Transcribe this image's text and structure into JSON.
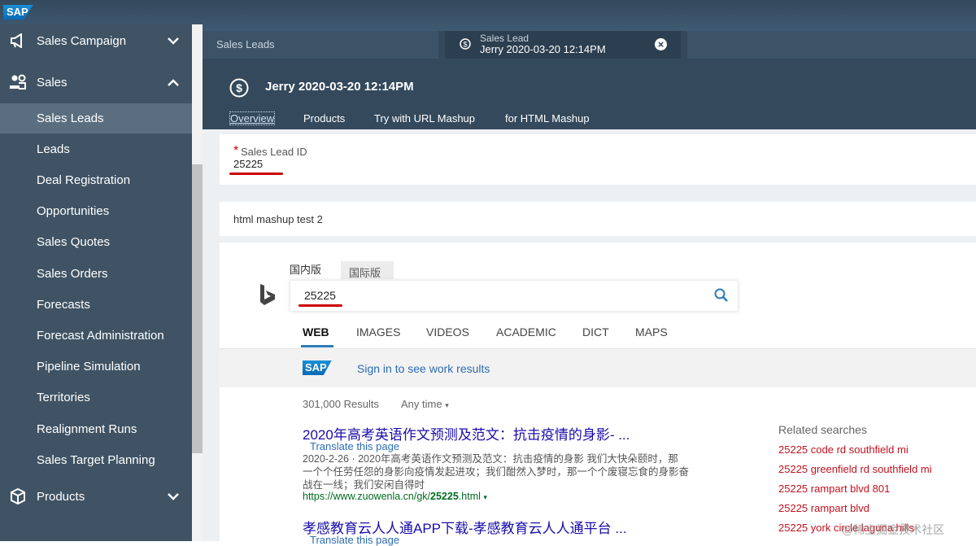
{
  "brand": {
    "logo": "SAP"
  },
  "sidebar": {
    "sales_campaign": "Sales Campaign",
    "sales": "Sales",
    "items": [
      "Sales Leads",
      "Leads",
      "Deal Registration",
      "Opportunities",
      "Sales Quotes",
      "Sales Orders",
      "Forecasts",
      "Forecast Administration",
      "Pipeline Simulation",
      "Territories",
      "Realignment Runs",
      "Sales Target Planning"
    ],
    "products": "Products",
    "icons": {
      "campaign": "megaphone-icon",
      "sales": "people-icon",
      "products": "box-icon"
    }
  },
  "tabs": {
    "tab1": "Sales Leads",
    "tab2_small": "Sales Lead",
    "tab2_main": "Jerry 2020-03-20 12:14PM",
    "tab2_close": "×"
  },
  "object": {
    "title": "Jerry 2020-03-20 12:14PM",
    "subtabs": [
      "Overview",
      "Products",
      "Try with URL Mashup",
      "for HTML Mashup"
    ]
  },
  "form": {
    "required_mark": "*",
    "lead_id_label": "Sales Lead ID",
    "lead_id_value": "25225",
    "mashup_title": "html mashup test 2"
  },
  "bing": {
    "region_tabs": [
      "国内版",
      "国际版"
    ],
    "query": "25225",
    "nav": [
      "WEB",
      "IMAGES",
      "VIDEOS",
      "ACADEMIC",
      "DICT",
      "MAPS"
    ],
    "sap_badge": "SAP",
    "signin": "Sign in to see work results",
    "result_count": "301,000 Results",
    "any_time": "Any time",
    "results": [
      {
        "title": "2020年高考英语作文预测及范文：抗击疫情的身影- ...",
        "translate": "Translate this page",
        "date": "2020-2-26",
        "snippet1": "2020年高考英语作文预测及范文：抗击疫情的身影 我们大快朵颐时，那",
        "snippet2": "一个个任劳任怨的身影向疫情发起进攻；我们酣然入梦时，那一个个废寝忘食的身影奋",
        "snippet3": "战在一线；我们安闲自得时",
        "url_prefix": "https://www.zuowenla.cn/gk/",
        "url_bold": "25225",
        "url_suffix": ".html"
      },
      {
        "title": "孝感教育云人人通APP下载-孝感教育云人人通平台 ...",
        "translate": "Translate this page"
      }
    ],
    "related_title": "Related searches",
    "related": [
      {
        "bold": "25225",
        "rest": " code rd southfield mi"
      },
      {
        "bold": "25225",
        "rest": " greenfield rd southfield mi"
      },
      {
        "bold": "25225",
        "rest": " rampart blvd 801"
      },
      {
        "bold": "25225",
        "rest": " rampart blvd"
      },
      {
        "bold": "25225",
        "rest": " york circle laguna hills"
      }
    ],
    "watermark": "@稀土掘金技术社区"
  },
  "colors": {
    "sidebar_bg": "#3f5364",
    "header_bg": "#34495c",
    "link": "#1a0dab",
    "related": "#c1121f",
    "underline": "#cc0000"
  }
}
